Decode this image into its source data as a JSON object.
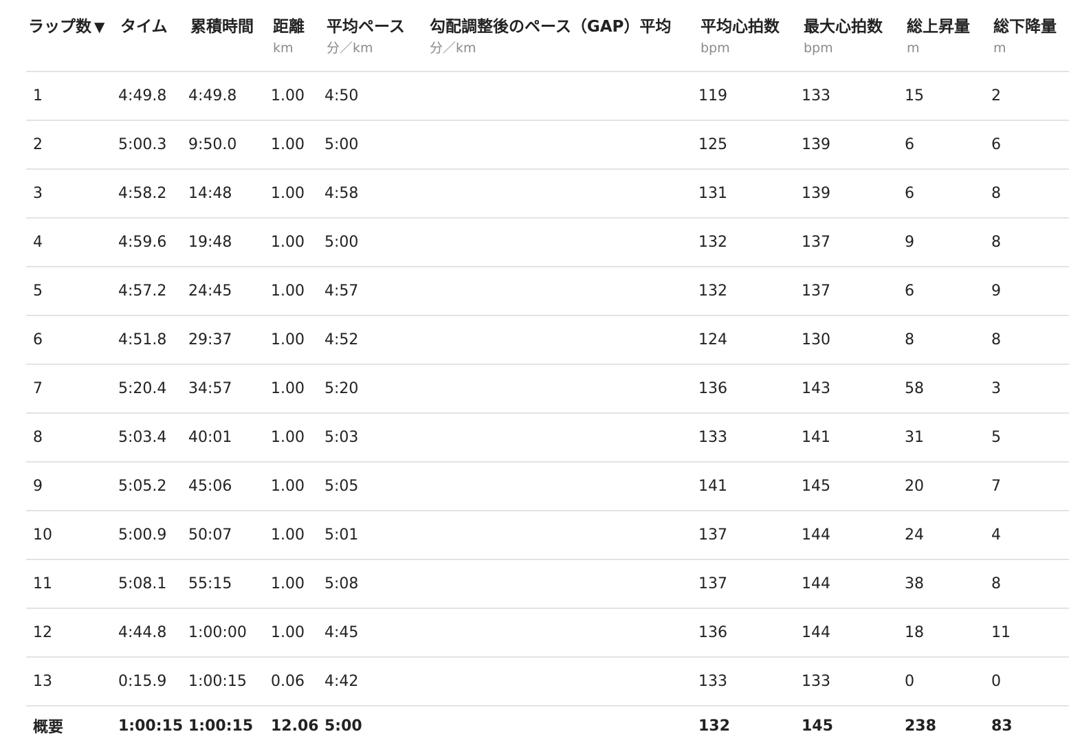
{
  "table": {
    "headers": [
      {
        "label": "ラップ数",
        "unit": ""
      },
      {
        "label": "タイム",
        "unit": ""
      },
      {
        "label": "累積時間",
        "unit": ""
      },
      {
        "label": "距離",
        "unit": "km"
      },
      {
        "label": "平均ペース",
        "unit": "分／km"
      },
      {
        "label": "勾配調整後のペース（GAP）平均",
        "unit": "分／km"
      },
      {
        "label": "平均心拍数",
        "unit": "bpm"
      },
      {
        "label": "最大心拍数",
        "unit": "bpm"
      },
      {
        "label": "総上昇量",
        "unit": "m"
      },
      {
        "label": "総下降量",
        "unit": "m"
      }
    ],
    "sort_indicator": "▼",
    "rows": [
      {
        "lap": "1",
        "time": "4:49.8",
        "cumulative": "4:49.8",
        "distance": "1.00",
        "avg_pace": "4:50",
        "gap": "",
        "avg_hr": "119",
        "max_hr": "133",
        "ascent": "15",
        "descent": "2"
      },
      {
        "lap": "2",
        "time": "5:00.3",
        "cumulative": "9:50.0",
        "distance": "1.00",
        "avg_pace": "5:00",
        "gap": "",
        "avg_hr": "125",
        "max_hr": "139",
        "ascent": "6",
        "descent": "6"
      },
      {
        "lap": "3",
        "time": "4:58.2",
        "cumulative": "14:48",
        "distance": "1.00",
        "avg_pace": "4:58",
        "gap": "",
        "avg_hr": "131",
        "max_hr": "139",
        "ascent": "6",
        "descent": "8"
      },
      {
        "lap": "4",
        "time": "4:59.6",
        "cumulative": "19:48",
        "distance": "1.00",
        "avg_pace": "5:00",
        "gap": "",
        "avg_hr": "132",
        "max_hr": "137",
        "ascent": "9",
        "descent": "8"
      },
      {
        "lap": "5",
        "time": "4:57.2",
        "cumulative": "24:45",
        "distance": "1.00",
        "avg_pace": "4:57",
        "gap": "",
        "avg_hr": "132",
        "max_hr": "137",
        "ascent": "6",
        "descent": "9"
      },
      {
        "lap": "6",
        "time": "4:51.8",
        "cumulative": "29:37",
        "distance": "1.00",
        "avg_pace": "4:52",
        "gap": "",
        "avg_hr": "124",
        "max_hr": "130",
        "ascent": "8",
        "descent": "8"
      },
      {
        "lap": "7",
        "time": "5:20.4",
        "cumulative": "34:57",
        "distance": "1.00",
        "avg_pace": "5:20",
        "gap": "",
        "avg_hr": "136",
        "max_hr": "143",
        "ascent": "58",
        "descent": "3"
      },
      {
        "lap": "8",
        "time": "5:03.4",
        "cumulative": "40:01",
        "distance": "1.00",
        "avg_pace": "5:03",
        "gap": "",
        "avg_hr": "133",
        "max_hr": "141",
        "ascent": "31",
        "descent": "5"
      },
      {
        "lap": "9",
        "time": "5:05.2",
        "cumulative": "45:06",
        "distance": "1.00",
        "avg_pace": "5:05",
        "gap": "",
        "avg_hr": "141",
        "max_hr": "145",
        "ascent": "20",
        "descent": "7"
      },
      {
        "lap": "10",
        "time": "5:00.9",
        "cumulative": "50:07",
        "distance": "1.00",
        "avg_pace": "5:01",
        "gap": "",
        "avg_hr": "137",
        "max_hr": "144",
        "ascent": "24",
        "descent": "4"
      },
      {
        "lap": "11",
        "time": "5:08.1",
        "cumulative": "55:15",
        "distance": "1.00",
        "avg_pace": "5:08",
        "gap": "",
        "avg_hr": "137",
        "max_hr": "144",
        "ascent": "38",
        "descent": "8"
      },
      {
        "lap": "12",
        "time": "4:44.8",
        "cumulative": "1:00:00",
        "distance": "1.00",
        "avg_pace": "4:45",
        "gap": "",
        "avg_hr": "136",
        "max_hr": "144",
        "ascent": "18",
        "descent": "11"
      },
      {
        "lap": "13",
        "time": "0:15.9",
        "cumulative": "1:00:15",
        "distance": "0.06",
        "avg_pace": "4:42",
        "gap": "",
        "avg_hr": "133",
        "max_hr": "133",
        "ascent": "0",
        "descent": "0"
      }
    ],
    "summary": {
      "lap": "概要",
      "time": "1:00:15",
      "cumulative": "1:00:15",
      "distance": "12.06",
      "avg_pace": "5:00",
      "gap": "",
      "avg_hr": "132",
      "max_hr": "145",
      "ascent": "238",
      "descent": "83"
    }
  }
}
